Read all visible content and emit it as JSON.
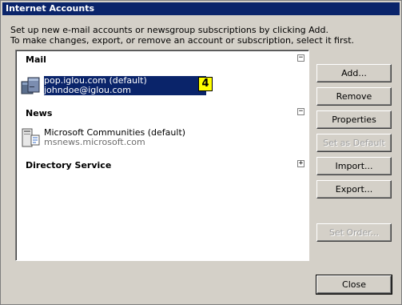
{
  "window": {
    "title": "Internet Accounts"
  },
  "instructions": {
    "line1": "Set up new e-mail accounts or newsgroup subscriptions by clicking Add.",
    "line2": "To make changes, export, or remove an account or subscription, select it first."
  },
  "groups": {
    "mail": {
      "header": "Mail",
      "toggle": "−",
      "account": {
        "name": "pop.iglou.com (default)",
        "detail": "johndoe@iglou.com",
        "icon": "mail-server-icon"
      }
    },
    "news": {
      "header": "News",
      "toggle": "−",
      "account": {
        "name": "Microsoft Communities (default)",
        "detail": "msnews.microsoft.com",
        "icon": "news-server-icon"
      }
    },
    "directory": {
      "header": "Directory Service",
      "toggle": "+"
    }
  },
  "step_badge": "4",
  "buttons": {
    "add": "Add...",
    "remove": "Remove",
    "properties": "Properties",
    "set_default": "Set as Default",
    "import": "Import...",
    "export": "Export...",
    "set_order": "Set Order...",
    "close": "Close"
  },
  "colors": {
    "titlebar": "#0a246a",
    "selection": "#0a246a",
    "dialog_bg": "#d4d0c8",
    "badge": "#ffff00"
  }
}
